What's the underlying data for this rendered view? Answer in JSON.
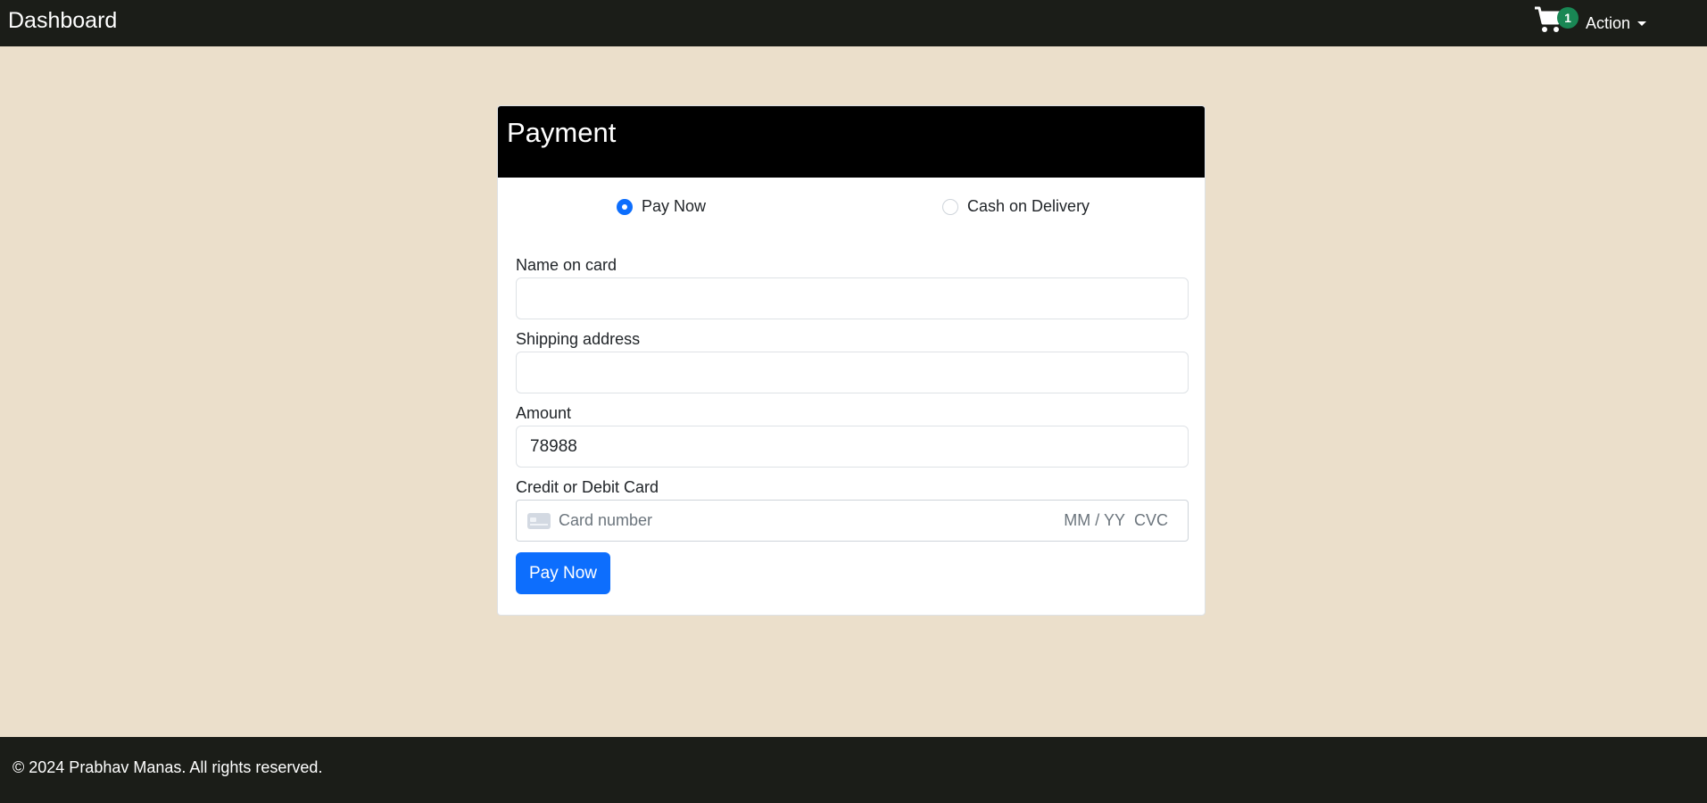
{
  "navbar": {
    "brand": "Dashboard",
    "cart_count": "1",
    "cart_icon": "cart-icon",
    "action_label": "Action"
  },
  "payment": {
    "title": "Payment",
    "options": [
      {
        "label": "Pay Now",
        "checked": true
      },
      {
        "label": "Cash on Delivery",
        "checked": false
      }
    ],
    "fields": {
      "name_label": "Name on card",
      "name_value": "",
      "address_label": "Shipping address",
      "address_value": "",
      "amount_label": "Amount",
      "amount_value": "78988",
      "card_label": "Credit or Debit Card",
      "card_number_placeholder": "Card number",
      "card_expiry_placeholder": "MM / YY",
      "card_cvc_placeholder": "CVC"
    },
    "submit_label": "Pay Now"
  },
  "footer": {
    "text": "© 2024 Prabhav Manas. All rights reserved."
  },
  "colors": {
    "background": "#ebdfcb",
    "navbar": "#1b1d18",
    "primary": "#0d6efd",
    "badge": "#198754"
  }
}
